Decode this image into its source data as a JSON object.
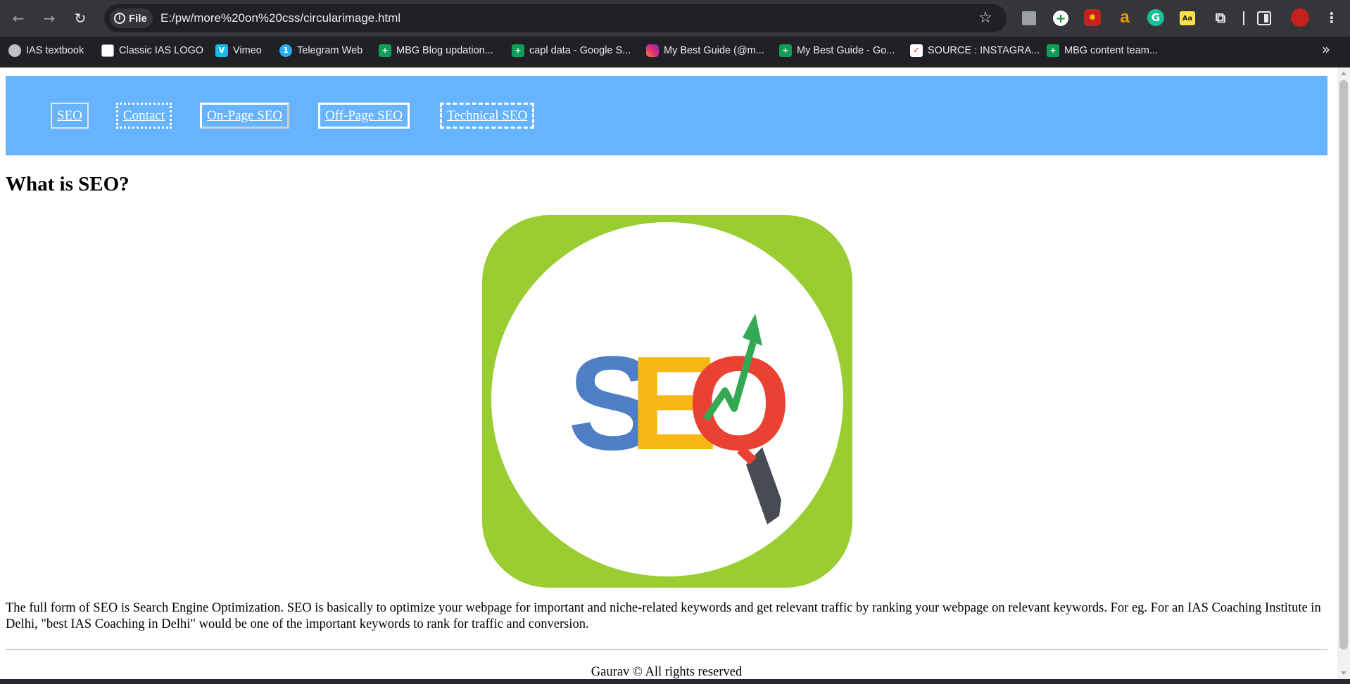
{
  "browser": {
    "site_info_label": "File",
    "url": "E:/pw/more%20on%20css/circularimage.html",
    "nav": {
      "back_glyph": "←",
      "forward_glyph": "→",
      "reload_glyph": "↻",
      "star_glyph": "☆",
      "menu_glyph": "⋮",
      "more_glyph": "»"
    },
    "extension_icons": [
      "extension-gray-icon",
      "add-circle-icon",
      "fire-extension-icon",
      "amazon-a-icon",
      "grammarly-icon",
      "aa-dictionary-icon",
      "puzzle-icon",
      "side-panel-icon",
      "profile-avatar"
    ],
    "bookmarks": [
      {
        "label": "IAS textbook",
        "icon": "ias-icon"
      },
      {
        "label": "Classic IAS LOGO",
        "icon": "logo-icon"
      },
      {
        "label": "Vimeo",
        "icon": "vimeo-icon",
        "glyph": "V"
      },
      {
        "label": "Telegram Web",
        "icon": "telegram-icon",
        "glyph": "1"
      },
      {
        "label": "MBG Blog updation...",
        "icon": "sheets-icon",
        "glyph": "+"
      },
      {
        "label": "capl data - Google S...",
        "icon": "sheets-icon",
        "glyph": "+"
      },
      {
        "label": "My Best Guide (@m...",
        "icon": "instagram-icon"
      },
      {
        "label": "My Best Guide - Go...",
        "icon": "sheets-icon",
        "glyph": "+"
      },
      {
        "label": "SOURCE : INSTAGRA...",
        "icon": "source-icon",
        "glyph": "✓"
      },
      {
        "label": "MBG content team...",
        "icon": "sheets-icon",
        "glyph": "+"
      }
    ]
  },
  "page": {
    "nav_links": [
      "SEO",
      "Contact",
      "On-Page SEO",
      "Off-Page SEO",
      "Technical SEO"
    ],
    "heading": "What is SEO?",
    "image_letters": [
      "S",
      "E",
      "O"
    ],
    "intro": "The full form of SEO is Search Engine Optimization. SEO is basically to optimize your webpage for important and niche-related keywords and get relevant traffic by ranking your webpage on relevant keywords. For eg. For an IAS Coaching Institute in Delhi, \"best IAS Coaching in Delhi\" would be one of the important keywords to rank for traffic and conversion.",
    "footer": "Gaurav © All rights reserved"
  },
  "colors": {
    "nav_bg": "#66b3ff",
    "image_frame": "#9acd32",
    "letter_s": "#4f7ec4",
    "letter_e": "#f7b813",
    "letter_o": "#e94233",
    "arrow": "#34a853",
    "handle": "#474b54"
  }
}
